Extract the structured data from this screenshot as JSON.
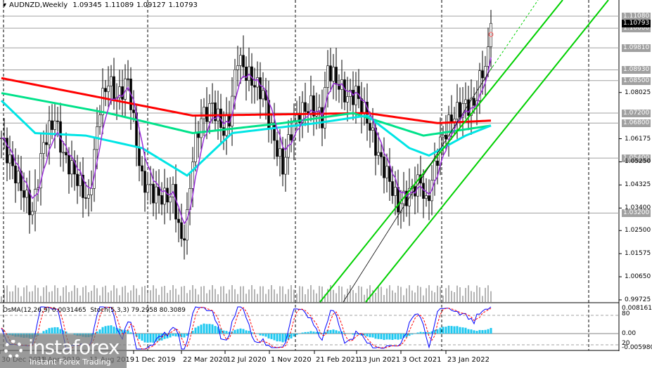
{
  "header": {
    "symbol": "AUDNZD,Weekly",
    "open": "1.09345",
    "high": "1.11089",
    "low": "1.09127",
    "close": "1.10793"
  },
  "subwindow": {
    "osma_label": "OsMA(12,26,9) 0.0031465",
    "stoch_label": "Stoch(5,3,3) 79.2958 80.3089",
    "osma_max": "0.0081614",
    "osma_min": "-0.005980",
    "level80": "80",
    "level20": "20",
    "zero": "0.00"
  },
  "price_axis": {
    "ticks": [
      "1.08025",
      "1.06175",
      "1.05250",
      "1.04325",
      "1.03400",
      "1.02500",
      "1.01575",
      "1.00650",
      "0.99725"
    ],
    "levels": [
      "1.11080",
      "1.10600",
      "1.09810",
      "1.08930",
      "1.08500",
      "1.07200",
      "1.06800",
      "1.05400",
      "1.03200"
    ],
    "current": "1.10793"
  },
  "time_axis": [
    "30 Dec 2018",
    "21 Apr 2019",
    "11 Aug 2019",
    "1 Dec 2019",
    "22 Mar 2020",
    "12 Jul 2020",
    "1 Nov 2020",
    "21 Feb 2021",
    "13 Jun 2021",
    "3 Oct 2021",
    "23 Jan 2022"
  ],
  "logo": {
    "name": "instaforex",
    "tagline": "Instant Forex Trading"
  },
  "chart_data": {
    "type": "candlestick",
    "title": "AUDNZD, Weekly",
    "ylim": [
      0.99725,
      1.1108
    ],
    "close_keypoints_week_price": [
      [
        0,
        1.062
      ],
      [
        4,
        1.05
      ],
      [
        8,
        1.04
      ],
      [
        11,
        1.032
      ],
      [
        15,
        1.06
      ],
      [
        19,
        1.07
      ],
      [
        22,
        1.055
      ],
      [
        26,
        1.048
      ],
      [
        31,
        1.036
      ],
      [
        35,
        1.075
      ],
      [
        38,
        1.085
      ],
      [
        41,
        1.078
      ],
      [
        45,
        1.085
      ],
      [
        48,
        1.06
      ],
      [
        50,
        1.045
      ],
      [
        54,
        1.04
      ],
      [
        58,
        1.038
      ],
      [
        61,
        1.04
      ],
      [
        64,
        1.02
      ],
      [
        66,
        1.03
      ],
      [
        68,
        1.055
      ],
      [
        71,
        1.07
      ],
      [
        75,
        1.075
      ],
      [
        79,
        1.065
      ],
      [
        81,
        1.07
      ],
      [
        84,
        1.095
      ],
      [
        86,
        1.09
      ],
      [
        89,
        1.085
      ],
      [
        93,
        1.08
      ],
      [
        96,
        1.065
      ],
      [
        100,
        1.05
      ],
      [
        103,
        1.065
      ],
      [
        106,
        1.072
      ],
      [
        110,
        1.075
      ],
      [
        114,
        1.07
      ],
      [
        116,
        1.09
      ],
      [
        119,
        1.085
      ],
      [
        123,
        1.078
      ],
      [
        126,
        1.08
      ],
      [
        130,
        1.07
      ],
      [
        134,
        1.055
      ],
      [
        138,
        1.045
      ],
      [
        141,
        1.035
      ],
      [
        145,
        1.04
      ],
      [
        149,
        1.045
      ],
      [
        151,
        1.035
      ],
      [
        154,
        1.05
      ],
      [
        156,
        1.06
      ],
      [
        160,
        1.07
      ],
      [
        164,
        1.075
      ],
      [
        168,
        1.075
      ],
      [
        170,
        1.085
      ],
      [
        173,
        1.095
      ],
      [
        174,
        1.10793
      ]
    ],
    "ma_red": [
      [
        0,
        1.086
      ],
      [
        68,
        1.071
      ],
      [
        130,
        1.072
      ],
      [
        155,
        1.068
      ],
      [
        174,
        1.069
      ]
    ],
    "ma_green": [
      [
        0,
        1.08
      ],
      [
        38,
        1.072
      ],
      [
        68,
        1.064
      ],
      [
        100,
        1.068
      ],
      [
        125,
        1.072
      ],
      [
        150,
        1.063
      ],
      [
        174,
        1.067
      ]
    ],
    "ma_cyan": [
      [
        0,
        1.077
      ],
      [
        12,
        1.064
      ],
      [
        30,
        1.063
      ],
      [
        50,
        1.058
      ],
      [
        66,
        1.047
      ],
      [
        82,
        1.064
      ],
      [
        112,
        1.068
      ],
      [
        130,
        1.071
      ],
      [
        145,
        1.058
      ],
      [
        152,
        1.055
      ],
      [
        165,
        1.063
      ],
      [
        174,
        1.067
      ]
    ]
  },
  "colors": {
    "up": "#000000",
    "red_ma": "#ff0000",
    "green_ma": "#00e28a",
    "cyan_ma": "#00e5e5",
    "purple": "#9b30d9",
    "channel": "#00d000",
    "osma": "#1ec8f0",
    "stoch_main": "#0000ff",
    "stoch_signal": "#ff0000"
  }
}
